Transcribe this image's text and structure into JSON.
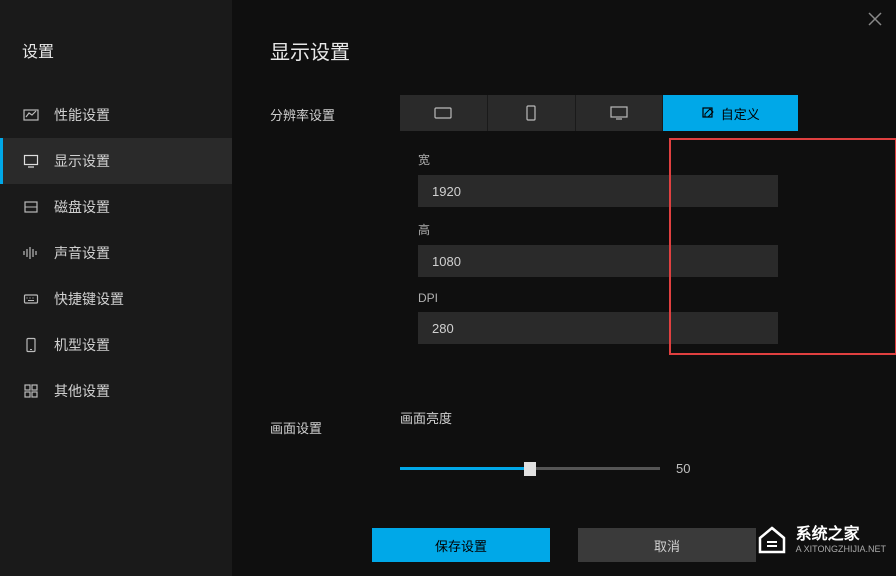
{
  "sidebar": {
    "title": "设置",
    "items": [
      {
        "label": "性能设置"
      },
      {
        "label": "显示设置"
      },
      {
        "label": "磁盘设置"
      },
      {
        "label": "声音设置"
      },
      {
        "label": "快捷键设置"
      },
      {
        "label": "机型设置"
      },
      {
        "label": "其他设置"
      }
    ]
  },
  "page": {
    "title": "显示设置"
  },
  "resolution": {
    "label": "分辨率设置",
    "customTab": "自定义",
    "widthLabel": "宽",
    "widthValue": "1920",
    "heightLabel": "高",
    "heightValue": "1080",
    "dpiLabel": "DPI",
    "dpiValue": "280"
  },
  "screen": {
    "label": "画面设置",
    "brightnessLabel": "画面亮度",
    "brightnessValue": "50"
  },
  "footer": {
    "save": "保存设置",
    "cancel": "取消"
  },
  "watermark": {
    "title": "系统之家",
    "sub": "A XITONGZHIJIA.NET"
  }
}
